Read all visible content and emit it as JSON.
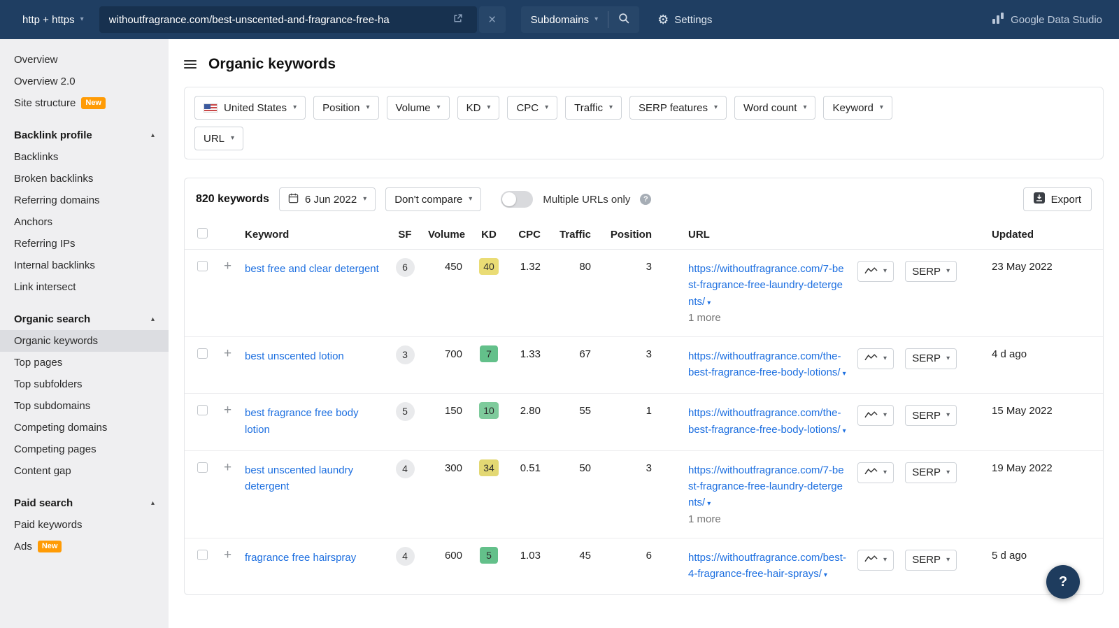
{
  "colors": {
    "topbar": "#1f3e62",
    "link": "#1d6fe0",
    "badge_new": "#ff9b05",
    "sidebar_active": "#dcdde1",
    "kd_green": "#63c08a",
    "kd_yellow": "#eadc75"
  },
  "topbar": {
    "protocol": "http + https",
    "target_url": "withoutfragrance.com/best-unscented-and-fragrance-free-ha",
    "scope": "Subdomains",
    "settings": "Settings",
    "brand": "Google Data Studio"
  },
  "sidebar": {
    "items": [
      {
        "label": "Overview"
      },
      {
        "label": "Overview 2.0"
      },
      {
        "label": "Site structure",
        "badge": "New"
      },
      {
        "label": "Backlink profile",
        "header": true
      },
      {
        "label": "Backlinks"
      },
      {
        "label": "Broken backlinks"
      },
      {
        "label": "Referring domains"
      },
      {
        "label": "Anchors"
      },
      {
        "label": "Referring IPs"
      },
      {
        "label": "Internal backlinks"
      },
      {
        "label": "Link intersect"
      },
      {
        "label": "Organic search",
        "header": true
      },
      {
        "label": "Organic keywords",
        "active": true
      },
      {
        "label": "Top pages"
      },
      {
        "label": "Top subfolders"
      },
      {
        "label": "Top subdomains"
      },
      {
        "label": "Competing domains"
      },
      {
        "label": "Competing pages"
      },
      {
        "label": "Content gap"
      },
      {
        "label": "Paid search",
        "header": true
      },
      {
        "label": "Paid keywords"
      },
      {
        "label": "Ads",
        "badge": "New"
      }
    ]
  },
  "page": {
    "title": "Organic keywords"
  },
  "filters": {
    "country": "United States",
    "row1": [
      "Position",
      "Volume",
      "KD",
      "CPC",
      "Traffic",
      "SERP features",
      "Word count",
      "Keyword"
    ],
    "row2": [
      "URL"
    ]
  },
  "toolbar": {
    "count": "820 keywords",
    "date": "6 Jun 2022",
    "compare": "Don't compare",
    "multiple_urls_label": "Multiple URLs only",
    "export_label": "Export"
  },
  "table": {
    "headers": {
      "keyword": "Keyword",
      "sf": "SF",
      "volume": "Volume",
      "kd": "KD",
      "cpc": "CPC",
      "traffic": "Traffic",
      "position": "Position",
      "url": "URL",
      "updated": "Updated"
    },
    "serp_label": "SERP",
    "rows": [
      {
        "keyword": "best free and clear detergent",
        "sf": "6",
        "volume": "450",
        "kd": "40",
        "kd_color": "#eadc75",
        "cpc": "1.32",
        "traffic": "80",
        "position": "3",
        "url": "https://withoutfragrance.com/7-best-fragrance-free-laundry-detergents/",
        "more": "1 more",
        "updated": "23 May 2022"
      },
      {
        "keyword": "best unscented lotion",
        "sf": "3",
        "volume": "700",
        "kd": "7",
        "kd_color": "#63c08a",
        "cpc": "1.33",
        "traffic": "67",
        "position": "3",
        "url": "https://withoutfragrance.com/the-best-fragrance-free-body-lotions/",
        "more": "",
        "updated": "4 d ago"
      },
      {
        "keyword": "best fragrance free body lotion",
        "sf": "5",
        "volume": "150",
        "kd": "10",
        "kd_color": "#7ecb9c",
        "cpc": "2.80",
        "traffic": "55",
        "position": "1",
        "url": "https://withoutfragrance.com/the-best-fragrance-free-body-lotions/",
        "more": "",
        "updated": "15 May 2022"
      },
      {
        "keyword": "best unscented laundry detergent",
        "sf": "4",
        "volume": "300",
        "kd": "34",
        "kd_color": "#e3d873",
        "cpc": "0.51",
        "traffic": "50",
        "position": "3",
        "url": "https://withoutfragrance.com/7-best-fragrance-free-laundry-detergents/",
        "more": "1 more",
        "updated": "19 May 2022"
      },
      {
        "keyword": "fragrance free hairspray",
        "sf": "4",
        "volume": "600",
        "kd": "5",
        "kd_color": "#63c08a",
        "cpc": "1.03",
        "traffic": "45",
        "position": "6",
        "url": "https://withoutfragrance.com/best-4-fragrance-free-hair-sprays/",
        "more": "",
        "updated": "5 d ago"
      }
    ]
  }
}
